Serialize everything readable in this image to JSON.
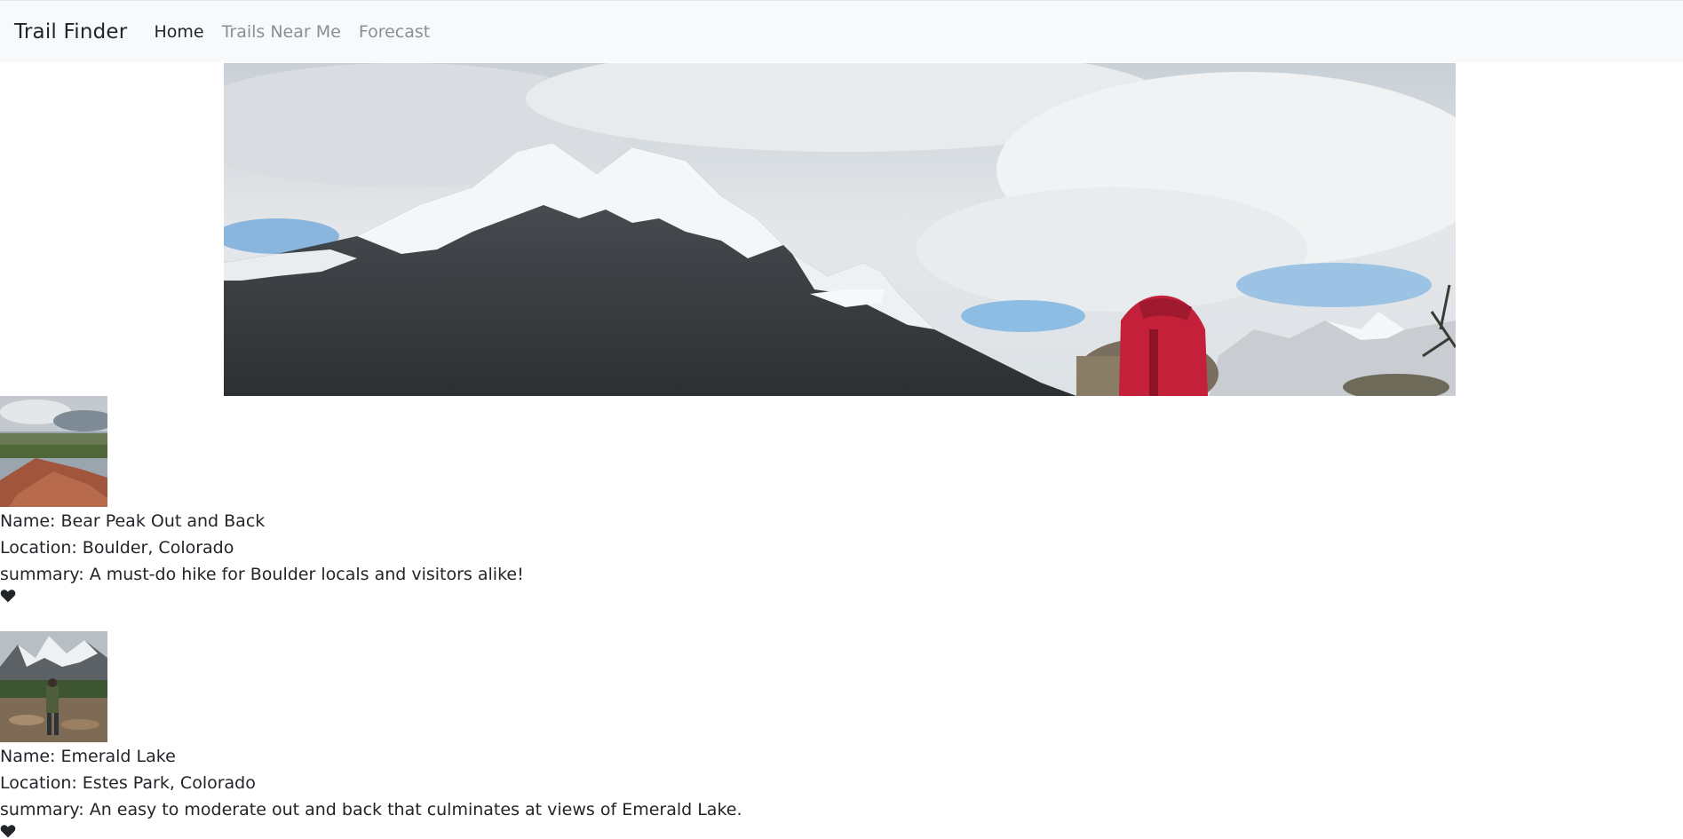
{
  "navbar": {
    "brand": "Trail Finder",
    "links": [
      {
        "label": "Home",
        "active": true
      },
      {
        "label": "Trails Near Me",
        "active": false
      },
      {
        "label": "Forecast",
        "active": false
      }
    ]
  },
  "hero": {
    "icon": "mountain-landscape-image"
  },
  "trails": [
    {
      "name_line": "Name: Bear Peak Out and Back",
      "location_line": "Location: Boulder, Colorado",
      "summary_line": "summary: A must-do hike for Boulder locals and visitors alike!",
      "favorite_icon": "heart-icon"
    },
    {
      "name_line": "Name: Emerald Lake",
      "location_line": "Location: Estes Park, Colorado",
      "summary_line": "summary: An easy to moderate out and back that culminates at views of Emerald Lake.",
      "favorite_icon": "heart-icon"
    }
  ],
  "colors": {
    "navbar_bg": "#f8f9fa",
    "active_link": "#212529",
    "inactive_link": "#8a8f94",
    "backpack_red": "#c5203a"
  }
}
